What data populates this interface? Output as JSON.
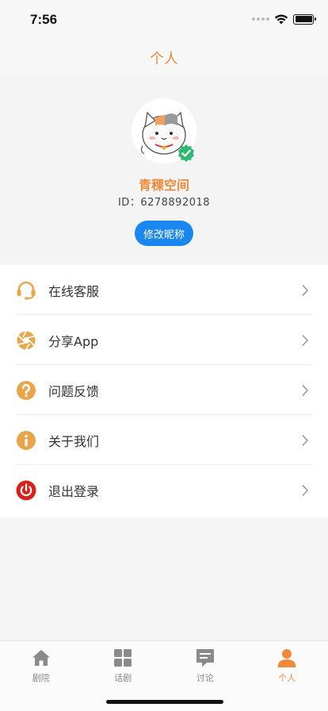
{
  "status_bar": {
    "time": "7:56"
  },
  "nav": {
    "title": "个人"
  },
  "profile": {
    "nickname": "青稞空间",
    "user_id": "ID：6278892018",
    "edit_button": "修改昵称"
  },
  "menu": {
    "items": [
      {
        "label": "在线客服",
        "icon": "headset-icon"
      },
      {
        "label": "分享App",
        "icon": "share-aperture-icon"
      },
      {
        "label": "问题反馈",
        "icon": "question-icon"
      },
      {
        "label": "关于我们",
        "icon": "info-icon"
      },
      {
        "label": "退出登录",
        "icon": "power-icon"
      }
    ]
  },
  "tabs": [
    {
      "label": "剧院",
      "icon": "home-icon",
      "active": false
    },
    {
      "label": "话剧",
      "icon": "grid-icon",
      "active": false
    },
    {
      "label": "讨论",
      "icon": "chat-icon",
      "active": false
    },
    {
      "label": "个人",
      "icon": "person-icon",
      "active": true
    }
  ],
  "colors": {
    "accent": "#f08a3a",
    "button_blue": "#1a86f0",
    "power_red": "#d9211c",
    "icon_orange": "#e8a54a"
  }
}
